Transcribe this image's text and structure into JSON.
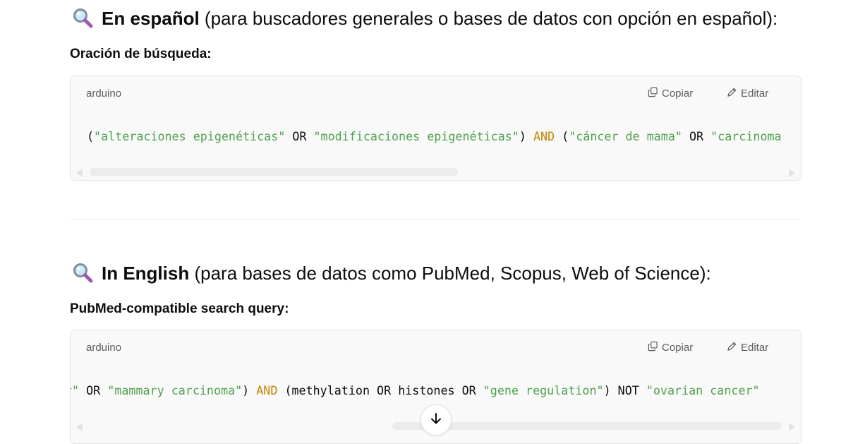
{
  "section_es": {
    "heading_bold": "En español",
    "heading_rest": " (para buscadores generales o bases de datos con opción en español):",
    "subheading": "Oración de búsqueda:",
    "code": {
      "language": "arduino",
      "copy_label": "Copiar",
      "edit_label": "Editar",
      "tokens": [
        {
          "t": "(",
          "c": ""
        },
        {
          "t": "\"alteraciones epigenéticas\"",
          "c": "s"
        },
        {
          "t": " OR ",
          "c": ""
        },
        {
          "t": "\"modificaciones epigenéticas\"",
          "c": "s"
        },
        {
          "t": ") ",
          "c": ""
        },
        {
          "t": "AND",
          "c": "k"
        },
        {
          "t": " (",
          "c": ""
        },
        {
          "t": "\"cáncer de mama\"",
          "c": "s"
        },
        {
          "t": " OR ",
          "c": ""
        },
        {
          "t": "\"carcinoma",
          "c": "s"
        }
      ]
    }
  },
  "section_en": {
    "heading_bold": "In English",
    "heading_rest": " (para bases de datos como PubMed, Scopus, Web of Science):",
    "subheading": "PubMed-compatible search query:",
    "code": {
      "language": "arduino",
      "copy_label": "Copiar",
      "edit_label": "Editar",
      "tokens": [
        {
          "t": "r\"",
          "c": "s"
        },
        {
          "t": " OR ",
          "c": ""
        },
        {
          "t": "\"mammary carcinoma\"",
          "c": "s"
        },
        {
          "t": ") ",
          "c": ""
        },
        {
          "t": "AND",
          "c": "k"
        },
        {
          "t": " (methylation OR histones OR ",
          "c": ""
        },
        {
          "t": "\"gene regulation\"",
          "c": "s"
        },
        {
          "t": ") NOT ",
          "c": ""
        },
        {
          "t": "\"ovarian cancer\"",
          "c": "s"
        }
      ]
    }
  },
  "colors": {
    "string": "#50a14f",
    "keyword": "#c18401",
    "code_background": "#f9f9f9"
  },
  "icons": [
    "magnifying-glass-icon",
    "copy-icon",
    "edit-icon",
    "arrow-down-icon"
  ]
}
